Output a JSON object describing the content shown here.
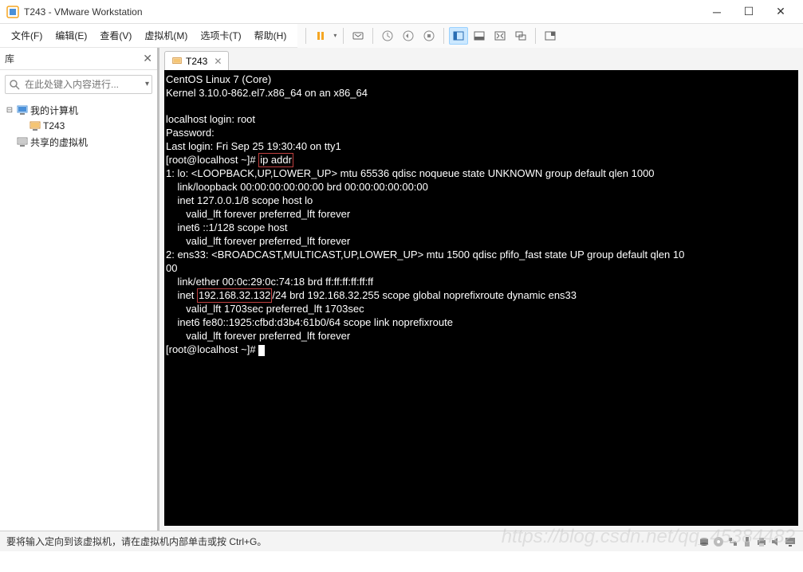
{
  "window": {
    "title": "T243 - VMware Workstation"
  },
  "menu": {
    "file": "文件(F)",
    "edit": "编辑(E)",
    "view": "查看(V)",
    "vm": "虚拟机(M)",
    "tabs": "选项卡(T)",
    "help": "帮助(H)"
  },
  "sidebar": {
    "title": "库",
    "search_placeholder": "在此处键入内容进行...",
    "tree": {
      "root": "我的计算机",
      "child": "T243",
      "shared": "共享的虚拟机"
    }
  },
  "tab": {
    "label": "T243"
  },
  "terminal": {
    "line1": "CentOS Linux 7 (Core)",
    "line2": "Kernel 3.10.0-862.el7.x86_64 on an x86_64",
    "line3": "",
    "line4": "localhost login: root",
    "line5": "Password:",
    "line6": "Last login: Fri Sep 25 19:30:40 on tty1",
    "prompt1a": "[root@localhost ~]# ",
    "cmd1": "ip addr",
    "out1": "1: lo: <LOOPBACK,UP,LOWER_UP> mtu 65536 qdisc noqueue state UNKNOWN group default qlen 1000",
    "out2": "    link/loopback 00:00:00:00:00:00 brd 00:00:00:00:00:00",
    "out3": "    inet 127.0.0.1/8 scope host lo",
    "out4": "       valid_lft forever preferred_lft forever",
    "out5": "    inet6 ::1/128 scope host",
    "out6": "       valid_lft forever preferred_lft forever",
    "out7": "2: ens33: <BROADCAST,MULTICAST,UP,LOWER_UP> mtu 1500 qdisc pfifo_fast state UP group default qlen 10",
    "out7b": "00",
    "out8": "    link/ether 00:0c:29:0c:74:18 brd ff:ff:ff:ff:ff:ff",
    "out9a": "    inet ",
    "ip": "192.168.32.132",
    "out9b": "/24 brd 192.168.32.255 scope global noprefixroute dynamic ens33",
    "out10": "       valid_lft 1703sec preferred_lft 1703sec",
    "out11": "    inet6 fe80::1925:cfbd:d3b4:61b0/64 scope link noprefixroute",
    "out12": "       valid_lft forever preferred_lft forever",
    "prompt2": "[root@localhost ~]# "
  },
  "status": {
    "text": "要将输入定向到该虚拟机，请在虚拟机内部单击或按 Ctrl+G。"
  },
  "watermark": "https://blog.csdn.net/qq_45384482"
}
